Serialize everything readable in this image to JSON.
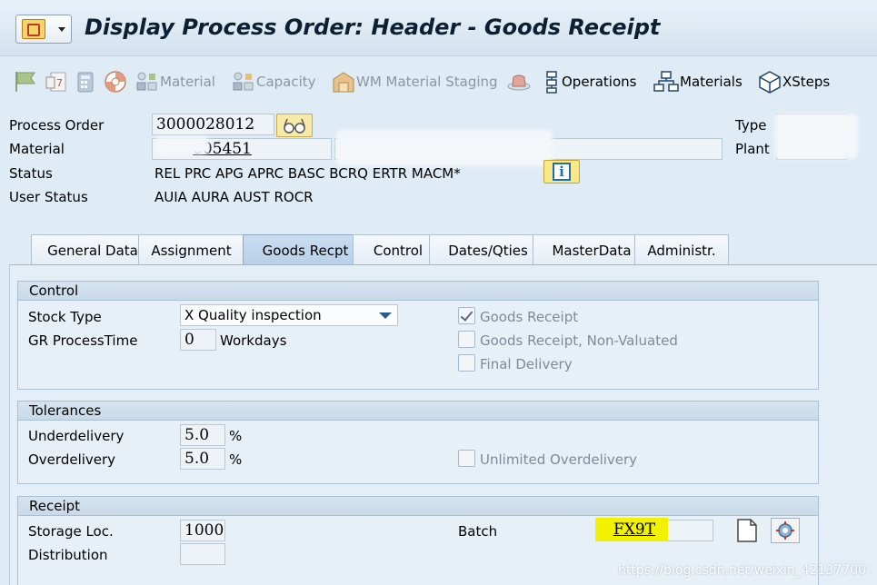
{
  "window": {
    "title": "Display Process Order: Header - Goods Receipt"
  },
  "toolbar": {
    "items": [
      {
        "icon": "flag-icon",
        "label": ""
      },
      {
        "icon": "calendar-icon",
        "label": ""
      },
      {
        "icon": "calculator-icon",
        "label": ""
      },
      {
        "icon": "lifebuoy-icon",
        "label": ""
      },
      {
        "icon": "material-components-icon",
        "label": "Material"
      },
      {
        "icon": "capacity-icon",
        "label": "Capacity"
      },
      {
        "icon": "wm-staging-icon",
        "label": "WM Material Staging"
      },
      {
        "icon": "hat-icon",
        "label": ""
      },
      {
        "icon": "operations-icon",
        "label": "Operations"
      },
      {
        "icon": "materials-hierarchy-icon",
        "label": "Materials"
      },
      {
        "icon": "xsteps-cube-icon",
        "label": "XSteps"
      }
    ]
  },
  "header": {
    "process_order_label": "Process Order",
    "process_order_value": "3000028012",
    "material_label": "Material",
    "material_value": "005451",
    "status_label": "Status",
    "status_value": "REL  PRC  APG  APRC BASC BCRQ ERTR MACM*",
    "user_status_label": "User Status",
    "user_status_value": "AUIA AURA AUST ROCR",
    "type_label": "Type",
    "plant_label": "Plant"
  },
  "tabs": [
    {
      "label": "General Data",
      "active": false
    },
    {
      "label": "Assignment",
      "active": false
    },
    {
      "label": "Goods Recpt",
      "active": true
    },
    {
      "label": "Control",
      "active": false
    },
    {
      "label": "Dates/Qties",
      "active": false
    },
    {
      "label": "MasterData",
      "active": false
    },
    {
      "label": "Administr.",
      "active": false
    }
  ],
  "control": {
    "title": "Control",
    "stock_type_label": "Stock Type",
    "stock_type_value": "X Quality inspection",
    "gr_processtime_label": "GR ProcessTime",
    "gr_processtime_value": "0",
    "gr_processtime_unit": "Workdays",
    "goods_receipt_label": "Goods Receipt",
    "goods_receipt_checked": true,
    "goods_receipt_nonvaluated_label": "Goods Receipt, Non-Valuated",
    "goods_receipt_nonvaluated_checked": false,
    "final_delivery_label": "Final Delivery",
    "final_delivery_checked": false
  },
  "tolerances": {
    "title": "Tolerances",
    "underdelivery_label": "Underdelivery",
    "underdelivery_value": "5.0",
    "overdelivery_label": "Overdelivery",
    "overdelivery_value": "5.0",
    "percent": "%",
    "unlimited_overdelivery_label": "Unlimited Overdelivery",
    "unlimited_overdelivery_checked": false
  },
  "receipt": {
    "title": "Receipt",
    "storage_loc_label": "Storage Loc.",
    "storage_loc_value": "1000",
    "distribution_label": "Distribution",
    "distribution_value": "",
    "batch_label": "Batch",
    "batch_value": "FX9T"
  },
  "watermark": "https://blog.csdn.net/weixin_42137700"
}
